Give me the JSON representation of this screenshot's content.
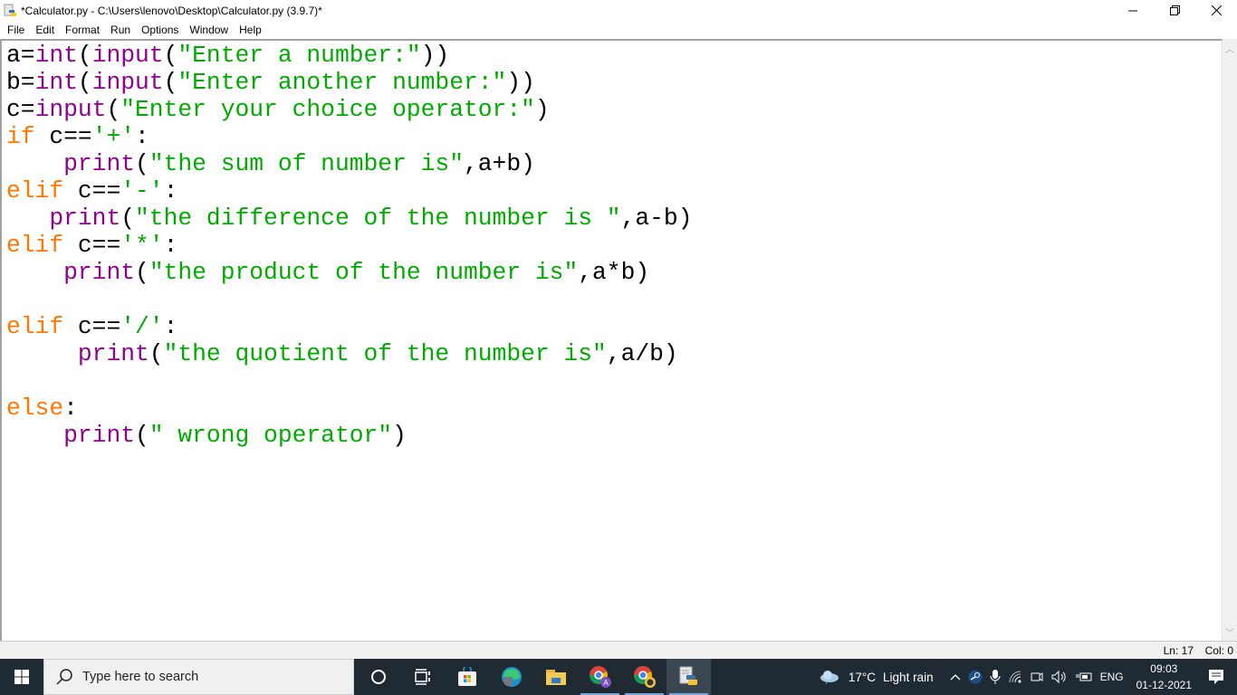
{
  "window": {
    "title": "*Calculator.py - C:\\Users\\lenovo\\Desktop\\Calculator.py (3.9.7)*",
    "controls": {
      "minimize": "—",
      "restore": "❐",
      "close": "✕"
    }
  },
  "menu": [
    "File",
    "Edit",
    "Format",
    "Run",
    "Options",
    "Window",
    "Help"
  ],
  "code_lines": [
    [
      {
        "t": "a=",
        "c": ""
      },
      {
        "t": "int",
        "c": "bi"
      },
      {
        "t": "(",
        "c": ""
      },
      {
        "t": "input",
        "c": "bi"
      },
      {
        "t": "(",
        "c": ""
      },
      {
        "t": "\"Enter a number:\"",
        "c": "str"
      },
      {
        "t": "))",
        "c": ""
      }
    ],
    [
      {
        "t": "b=",
        "c": ""
      },
      {
        "t": "int",
        "c": "bi"
      },
      {
        "t": "(",
        "c": ""
      },
      {
        "t": "input",
        "c": "bi"
      },
      {
        "t": "(",
        "c": ""
      },
      {
        "t": "\"Enter another number:\"",
        "c": "str"
      },
      {
        "t": "))",
        "c": ""
      }
    ],
    [
      {
        "t": "c=",
        "c": ""
      },
      {
        "t": "input",
        "c": "bi"
      },
      {
        "t": "(",
        "c": ""
      },
      {
        "t": "\"Enter your choice operator:\"",
        "c": "str"
      },
      {
        "t": ")",
        "c": ""
      }
    ],
    [
      {
        "t": "if",
        "c": "kw"
      },
      {
        "t": " c==",
        "c": ""
      },
      {
        "t": "'+'",
        "c": "str"
      },
      {
        "t": ":",
        "c": ""
      }
    ],
    [
      {
        "t": "    ",
        "c": ""
      },
      {
        "t": "print",
        "c": "bi"
      },
      {
        "t": "(",
        "c": ""
      },
      {
        "t": "\"the sum of number is\"",
        "c": "str"
      },
      {
        "t": ",a+b)",
        "c": ""
      }
    ],
    [
      {
        "t": "elif",
        "c": "kw"
      },
      {
        "t": " c==",
        "c": ""
      },
      {
        "t": "'-'",
        "c": "str"
      },
      {
        "t": ":",
        "c": ""
      }
    ],
    [
      {
        "t": "   ",
        "c": ""
      },
      {
        "t": "print",
        "c": "bi"
      },
      {
        "t": "(",
        "c": ""
      },
      {
        "t": "\"the difference of the number is \"",
        "c": "str"
      },
      {
        "t": ",a-b)",
        "c": ""
      }
    ],
    [
      {
        "t": "elif",
        "c": "kw"
      },
      {
        "t": " c==",
        "c": ""
      },
      {
        "t": "'*'",
        "c": "str"
      },
      {
        "t": ":",
        "c": ""
      }
    ],
    [
      {
        "t": "    ",
        "c": ""
      },
      {
        "t": "print",
        "c": "bi"
      },
      {
        "t": "(",
        "c": ""
      },
      {
        "t": "\"the product of the number is\"",
        "c": "str"
      },
      {
        "t": ",a*b)",
        "c": ""
      }
    ],
    [],
    [
      {
        "t": "elif",
        "c": "kw"
      },
      {
        "t": " c==",
        "c": ""
      },
      {
        "t": "'/'",
        "c": "str"
      },
      {
        "t": ":",
        "c": ""
      }
    ],
    [
      {
        "t": "     ",
        "c": ""
      },
      {
        "t": "print",
        "c": "bi"
      },
      {
        "t": "(",
        "c": ""
      },
      {
        "t": "\"the quotient of the number is\"",
        "c": "str"
      },
      {
        "t": ",a/b)",
        "c": ""
      }
    ],
    [],
    [
      {
        "t": "else",
        "c": "kw"
      },
      {
        "t": ":",
        "c": ""
      }
    ],
    [
      {
        "t": "    ",
        "c": ""
      },
      {
        "t": "print",
        "c": "bi"
      },
      {
        "t": "(",
        "c": ""
      },
      {
        "t": "\" wrong operator\"",
        "c": "str"
      },
      {
        "t": ")",
        "c": ""
      }
    ]
  ],
  "status": {
    "ln": "Ln: 17",
    "col": "Col: 0"
  },
  "taskbar": {
    "search_placeholder": "Type here to search",
    "apps": [
      "cortana-icon",
      "task-view-icon",
      "microsoft-store-icon",
      "edge-icon",
      "file-explorer-icon",
      "chrome-profile-a-icon",
      "chrome-profile-b-icon",
      "idle-python-icon"
    ],
    "weather": {
      "temp": "17°C",
      "desc": "Light rain"
    },
    "language": "ENG",
    "time": "09:03",
    "date": "01-12-2021"
  }
}
